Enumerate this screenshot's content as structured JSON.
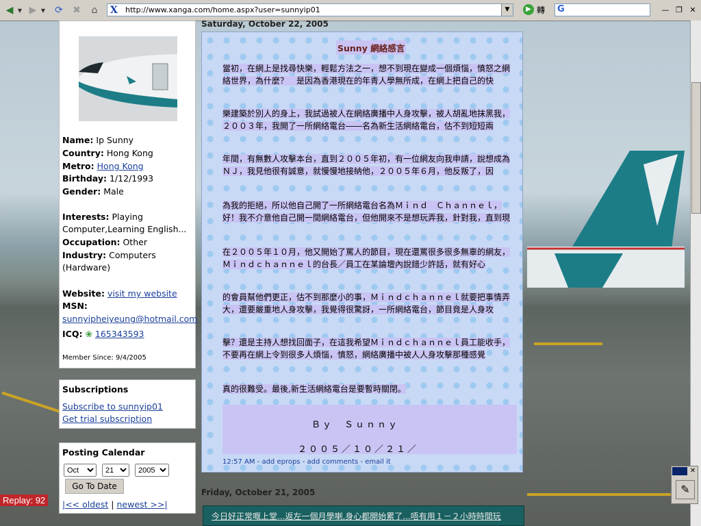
{
  "browser": {
    "url": "http://www.xanga.com/home.aspx?user=sunnyip01",
    "go_label": "轉",
    "search_logo": "G"
  },
  "profile": {
    "fields": [
      {
        "label": "Name:",
        "value": "Ip Sunny",
        "link": false
      },
      {
        "label": "Country:",
        "value": "Hong Kong",
        "link": false
      },
      {
        "label": "Metro:",
        "value": "Hong Kong",
        "link": true
      },
      {
        "label": "Birthday:",
        "value": "1/12/1993",
        "link": false
      },
      {
        "label": "Gender:",
        "value": "Male",
        "link": false
      }
    ],
    "interests_label": "Interests:",
    "interests_value": "Playing",
    "interests_value2": "Computer,Learning English...",
    "occupation_label": "Occupation:",
    "occupation_value": "Other",
    "industry_label": "Industry:",
    "industry_value": "Computers",
    "industry_value2": "(Hardware)",
    "website_label": "Website:",
    "website_link": "visit my website",
    "msn_label": "MSN:",
    "msn_value": "sunnyipheiyeung@hotmail.com",
    "icq_label": "ICQ:",
    "icq_value": "165343593",
    "member_since": "Member Since: 9/4/2005"
  },
  "subscriptions": {
    "title": "Subscriptions",
    "subscribe": "Subscribe to sunnyip01",
    "trial": "Get trial subscription"
  },
  "calendar": {
    "title": "Posting Calendar",
    "month": "Oct",
    "day": "21",
    "year": "2005",
    "go": "Go To Date",
    "oldest": "|<< oldest",
    "sep": "|",
    "newest": "newest >>|"
  },
  "posts": {
    "date1": "Saturday, October 22, 2005",
    "title": "Sunny 網絡感言",
    "paragraphs": [
      "當初，在網上是找尋快樂，輕鬆方法之一，想不到現在變成一個煩惱，憤怒之網絡世界，為什麼？　是因為香港現在的年青人學無所成，在網上把自己的快",
      "樂建築於別人的身上，我試過被人在網絡廣播中人身攻擊，被人胡亂地抹黑我，２００３年，我開了一所網絡電台――名為新生活網絡電台，估不到短短兩",
      "年間，有無數人攻擊本台，直到２００５年初，有一位網友向我申請，說想成為ＮＪ，我見他很有誠意，就慢慢地接納他，２００５年６月，他反叛了，因",
      "為我的拒絕，所以他自己開了一所網絡電台名為Ｍｉｎｄ　Ｃｈａｎｎｅｌ，好！我不介意他自己開一間網絡電台，但他開來不是想玩弄我，針對我，直到現",
      "在２００５年１０月，他又開始了罵人的節目，現在還罵很多很多無辜的網友，Ｍｉｎｄｃｈａｎｎｅｌ的台長／員工在某論壇內說錯少許話，就有好心",
      "的會員幫他們更正，估不到那麼小的事，Ｍｉｎｄｃｈａｎｎｅｌ就要把事情弄大，還要嚴重地人身攻擊，我覺得很驚訝，一所網絡電台，節目竟是人身攻",
      "擊？還是主持人想找回面子，在這我希望Ｍｉｎｄｃｈａｎｎｅｌ員工能收手，不要再在網上令到很多人煩惱，憤怒，網絡廣播中被人人身攻擊那種感覺",
      "真的很難受。最後,新生活網絡電台是要暫時關閉。"
    ],
    "signature": "Ｂｙ　Ｓｕｎｎｙ",
    "sig_date": "２００５／１０／２１／",
    "time": "12:57 AM",
    "add_eprops": "add eprops",
    "add_comments": "add comments",
    "email_it": "email it",
    "date2": "Friday, October 21, 2005",
    "next_preview": "今日好正常嘅上堂...返左一個月學喇,身心都開始累了...唔有用１－２小時時間玩"
  },
  "overlay": {
    "replay": "Replay: 92"
  }
}
